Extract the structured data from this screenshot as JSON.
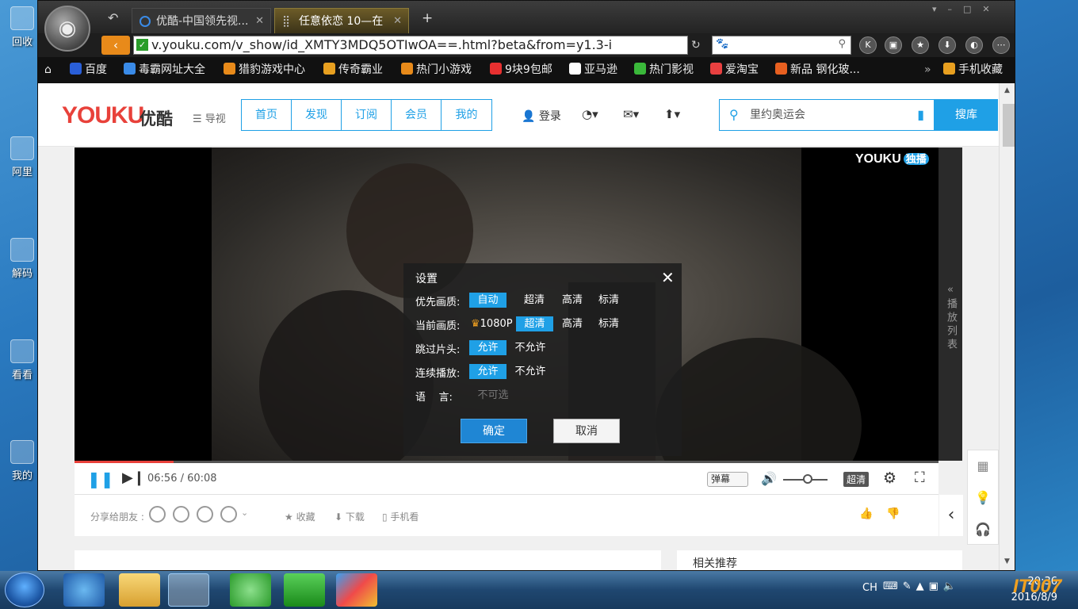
{
  "desktop": {
    "icons": [
      {
        "label": "回收"
      },
      {
        "label": "阿里"
      },
      {
        "label": "解码"
      },
      {
        "label": "看看"
      },
      {
        "label": "我的"
      }
    ]
  },
  "browser": {
    "tabs": [
      {
        "title": "优酷-中国领先视..."
      },
      {
        "title": "任意依恋  10—在"
      }
    ],
    "url": "v.youku.com/v_show/id_XMTY3MDQ5OTIwOA==.html?beta&from=y1.3-i",
    "bookmarks": [
      {
        "label": "百度",
        "color": "#2a5fd8"
      },
      {
        "label": "毒霸网址大全",
        "color": "#3a8be8"
      },
      {
        "label": "猎豹游戏中心",
        "color": "#e88a1a"
      },
      {
        "label": "传奇霸业",
        "color": "#e8a020"
      },
      {
        "label": "热门小游戏",
        "color": "#e88a1a"
      },
      {
        "label": "9块9包邮",
        "color": "#e83030"
      },
      {
        "label": "亚马逊",
        "color": "#fff"
      },
      {
        "label": "热门影视",
        "color": "#3ab83a"
      },
      {
        "label": "爱淘宝",
        "color": "#e84040"
      },
      {
        "label": "新品 钢化玻...",
        "color": "#e86020"
      }
    ],
    "mobile_fav": "手机收藏"
  },
  "youku": {
    "logo": "YOUKU",
    "logo_cn": "优酷",
    "guide": "导视",
    "nav": [
      "首页",
      "发现",
      "订阅",
      "会员",
      "我的"
    ],
    "login": "登录",
    "search_text": "里约奥运会",
    "search_btn": "搜库",
    "watermark": "YOUKU",
    "watermark_badge": "独播",
    "playlist_label": "播放列表"
  },
  "dialog": {
    "title": "设置",
    "rows": [
      {
        "label": "优先画质:",
        "options": [
          "自动",
          "超清",
          "高清",
          "标清"
        ],
        "selected": "自动"
      },
      {
        "label": "当前画质:",
        "options": [
          "1080P",
          "超清",
          "高清",
          "标清"
        ],
        "selected": "超清"
      },
      {
        "label": "跳过片头:",
        "options": [
          "允许",
          "不允许"
        ],
        "selected": "允许"
      },
      {
        "label": "连续播放:",
        "options": [
          "允许",
          "不允许"
        ],
        "selected": "允许"
      },
      {
        "label": "语    言:",
        "options": [
          "不可选"
        ],
        "selected": ""
      }
    ],
    "ok": "确定",
    "cancel": "取消"
  },
  "player": {
    "time": "06:56 / 60:08",
    "progress": 0.115,
    "danmu": "弹幕",
    "quality": "超清",
    "volume": 0.55
  },
  "share": {
    "label": "分享给朋友 :",
    "fav": "收藏",
    "download": "下载",
    "mobile": "手机看"
  },
  "lower": {
    "right_title": "相关推荐"
  },
  "taskbar": {
    "lang": "CH",
    "time": "20:36",
    "date": "2016/8/9",
    "brand": "IT007"
  }
}
